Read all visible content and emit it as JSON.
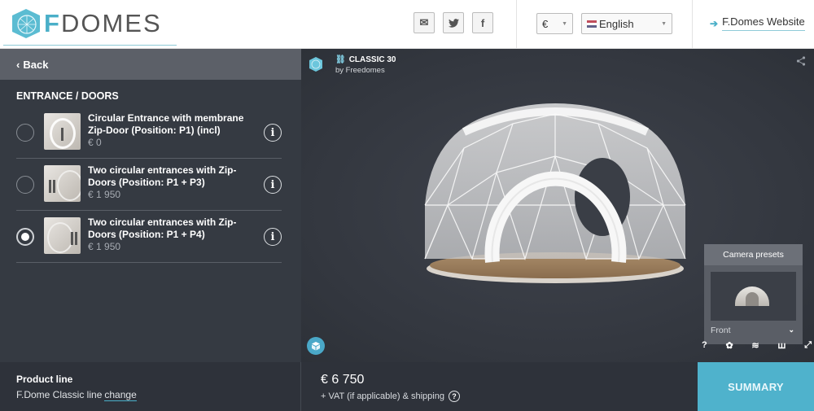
{
  "header": {
    "logo": {
      "brand_letter": "F",
      "brand_rest": "DOMES",
      "accent": "#4aafc8"
    },
    "social": [
      {
        "icon": "mail-icon",
        "glyph": "✉"
      },
      {
        "icon": "twitter-icon",
        "glyph": "t"
      },
      {
        "icon": "facebook-icon",
        "glyph": "f"
      }
    ],
    "currency": {
      "selected": "€"
    },
    "language": {
      "selected": "English"
    },
    "website_link": {
      "label": "F.Domes Website",
      "arrow": "➔"
    }
  },
  "sidebar": {
    "back_label": "Back",
    "back_glyph": "‹",
    "section_title": "ENTRANCE / DOORS",
    "options": [
      {
        "title": "Circular Entrance with membrane Zip-Door (Position: P1) (incl)",
        "price": "€ 0",
        "selected": false
      },
      {
        "title": "Two circular entrances with Zip-Doors (Position: P1 + P3)",
        "price": "€ 1 950",
        "selected": false
      },
      {
        "title": "Two circular entrances with Zip-Doors (Position: P1 + P4)",
        "price": "€ 1 950",
        "selected": true
      }
    ],
    "info_glyph": "i"
  },
  "viewer": {
    "product_name": "CLASSIC 30",
    "product_by": "by Freedomes",
    "camera_presets": {
      "title": "Camera presets",
      "selected": "Front",
      "chevron": "⌄"
    },
    "tools": [
      {
        "icon": "help-icon",
        "glyph": "?"
      },
      {
        "icon": "settings-icon",
        "glyph": "✿"
      },
      {
        "icon": "layers-icon",
        "glyph": "≋"
      },
      {
        "icon": "vr-icon",
        "glyph": "ꟺ"
      },
      {
        "icon": "fullscreen-icon",
        "glyph": "⤢"
      }
    ]
  },
  "footer": {
    "product_line_label": "Product line",
    "product_line_value": "F.Dome Classic line",
    "change_label": "change",
    "price": "€ 6 750",
    "vat_note": "+ VAT (if applicable) & shipping",
    "vat_help": "?",
    "summary_label": "SUMMARY"
  },
  "colors": {
    "accent": "#4fb2cc",
    "sidebar_bg": "#353a42",
    "footer_bg": "#2e323a"
  }
}
